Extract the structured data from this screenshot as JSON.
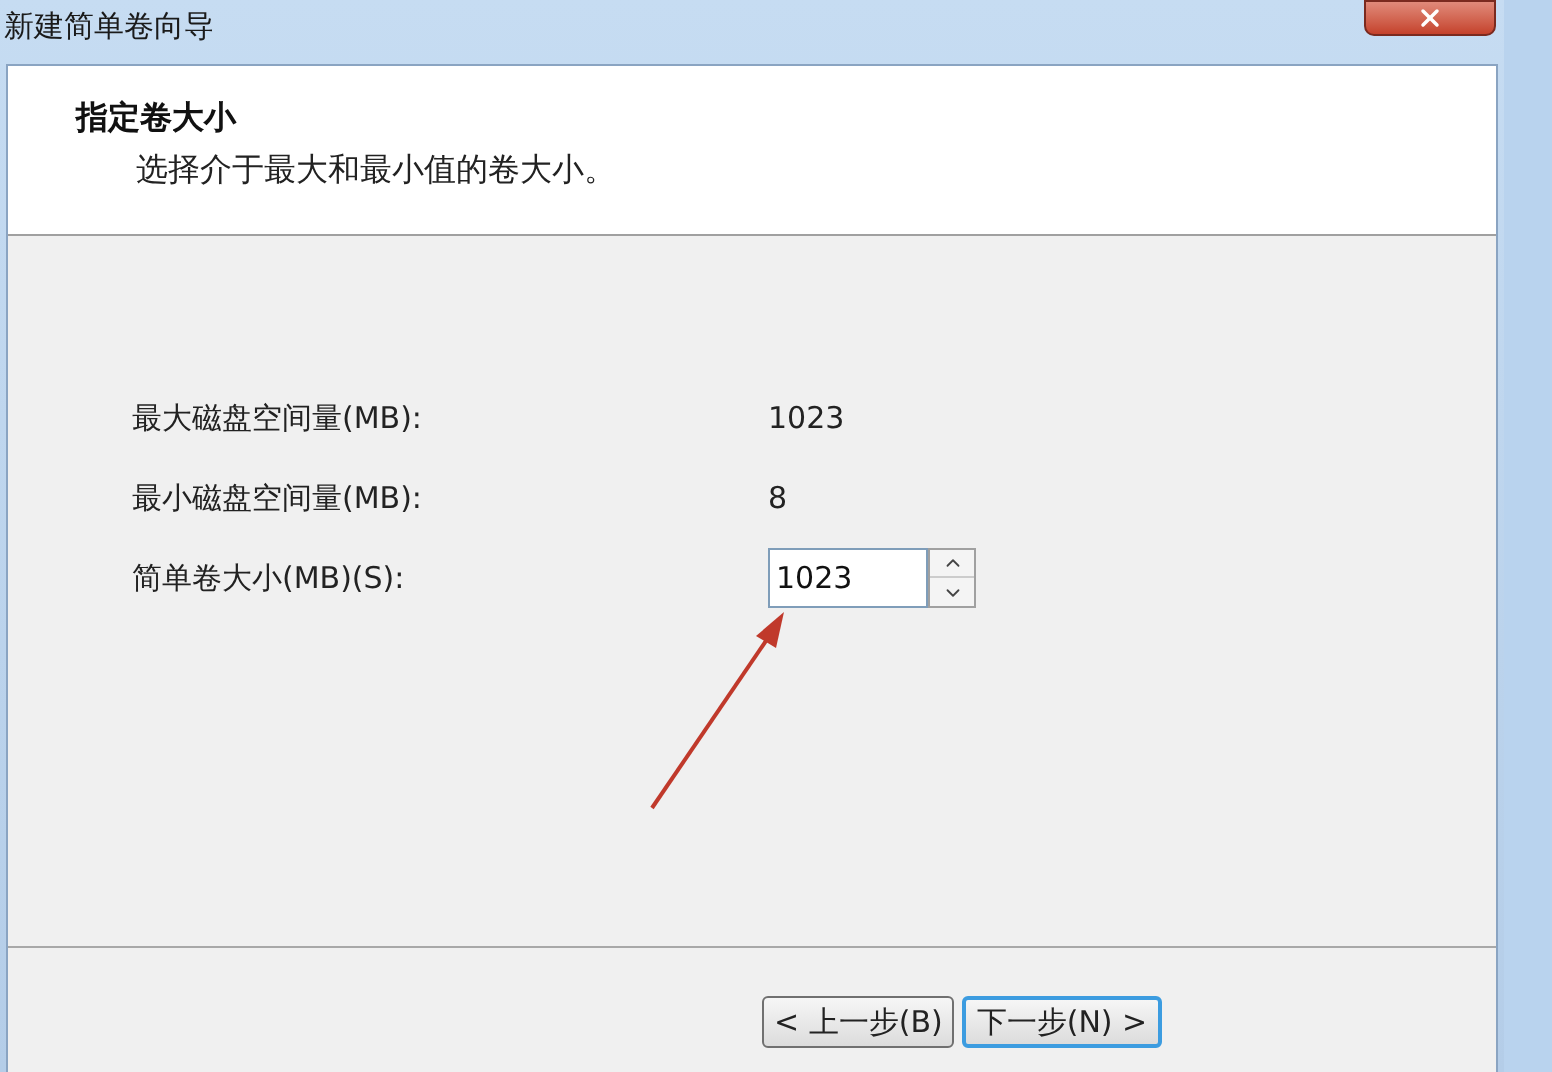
{
  "window": {
    "title": "新建简单卷向导"
  },
  "header": {
    "title": "指定卷大小",
    "subtitle": "选择介于最大和最小值的卷大小。"
  },
  "fields": [
    {
      "kind": "info",
      "label": "最大磁盘空间量(MB):",
      "value": "1023"
    },
    {
      "kind": "info",
      "label": "最小磁盘空间量(MB):",
      "value": "8"
    },
    {
      "kind": "spin",
      "label": "简单卷大小(MB)(S):",
      "value": "1023"
    }
  ],
  "buttons": [
    {
      "label": "< 上一步(B)",
      "default": false
    },
    {
      "label": "下一步(N) >",
      "default": true
    }
  ]
}
